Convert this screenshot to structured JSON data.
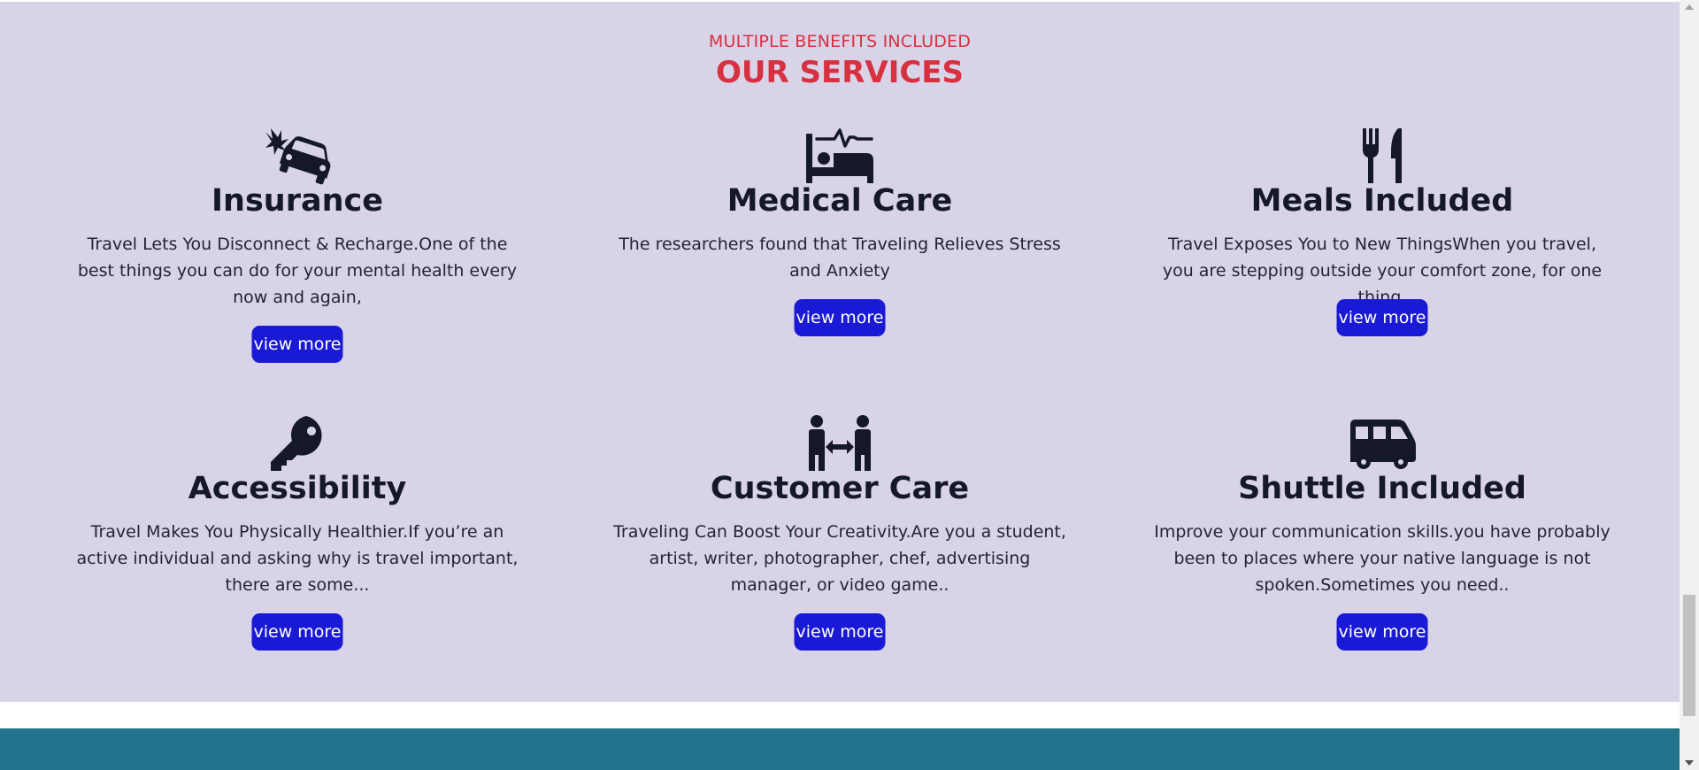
{
  "section": {
    "eyebrow": "MULTIPLE BENEFITS INCLUDED",
    "heading": "OUR SERVICES"
  },
  "services": [
    {
      "icon": "car-crash-icon",
      "title": "Insurance",
      "description": "Travel Lets You Disconnect & Recharge.One of the best things you can do for your mental health every now and again,",
      "button_label": "view more"
    },
    {
      "icon": "bed-pulse-icon",
      "title": "Medical Care",
      "description": "The researchers found that Traveling Relieves Stress and Anxiety",
      "button_label": "view more"
    },
    {
      "icon": "utensils-icon",
      "title": "Meals Included",
      "description": "Travel Exposes You to New ThingsWhen you travel, you are stepping outside your comfort zone, for one thing.",
      "button_label": "view more"
    },
    {
      "icon": "key-icon",
      "title": "Accessibility",
      "description": "Travel Makes You Physically Healthier.If you’re an active individual and asking why is travel important, there are some...",
      "button_label": "view more"
    },
    {
      "icon": "people-arrows-icon",
      "title": "Customer Care",
      "description": "Traveling Can Boost Your Creativity.Are you a student, artist, writer, photographer, chef, advertising manager, or video game..",
      "button_label": "view more"
    },
    {
      "icon": "van-shuttle-icon",
      "title": "Shuttle Included",
      "description": "Improve your communication skills.you have probably been to places where your native language is not spoken.Sometimes you need..",
      "button_label": "view more"
    }
  ],
  "colors": {
    "section_background": "#d9d3e8",
    "accent_red": "#d7303f",
    "button_blue": "#1a1ad6",
    "text_dark": "#14182a",
    "footer_teal": "#22748c"
  }
}
